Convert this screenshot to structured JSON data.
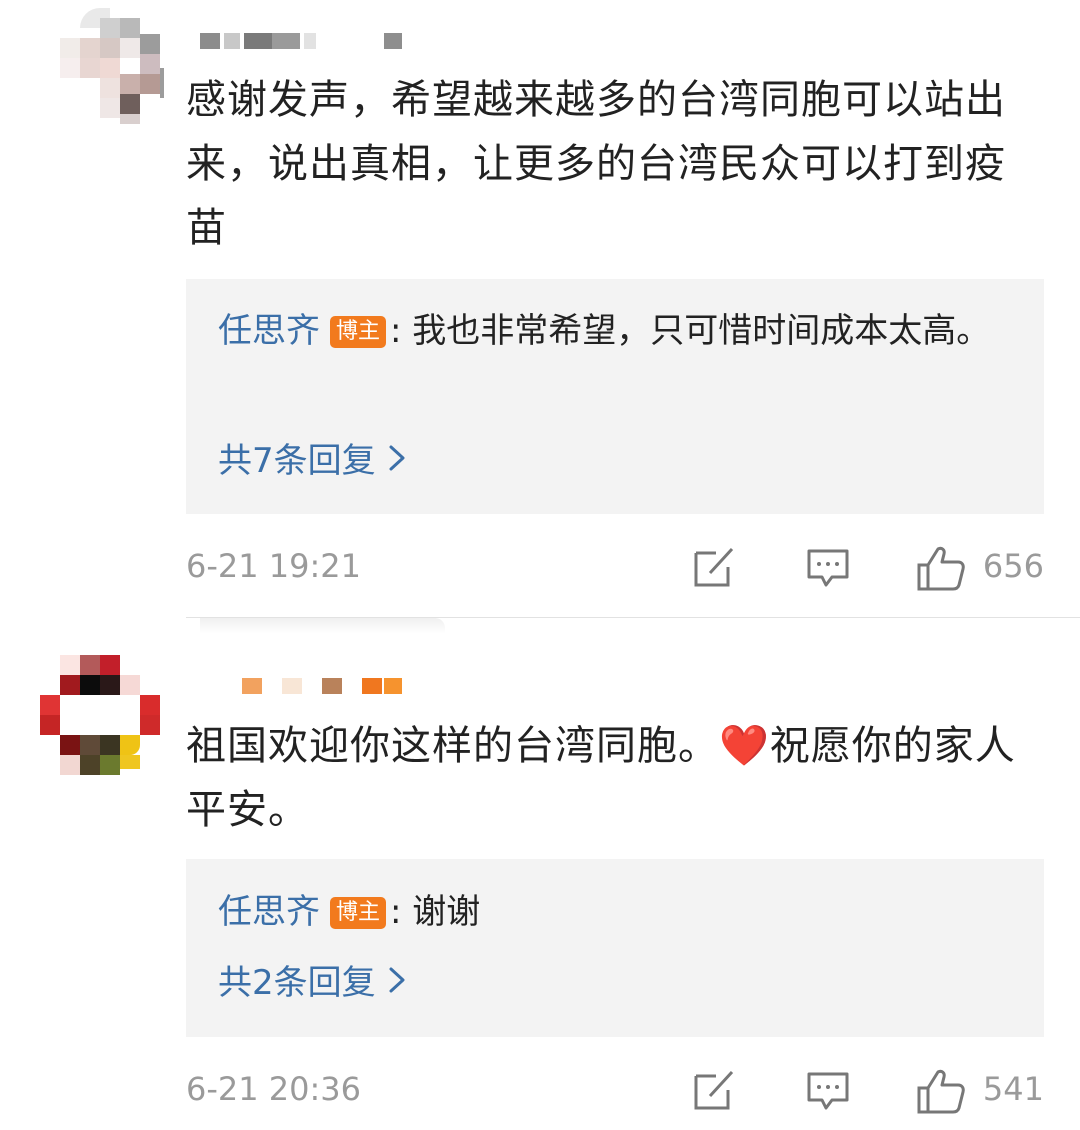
{
  "comments": [
    {
      "content": "感谢发声，希望越来越多的台湾同胞可以站出来，说出真相，让更多的台湾民众可以打到疫苗",
      "reply": {
        "author": "任思齐",
        "badge": "博主",
        "separator": ":",
        "text": " 我也非常希望，只可惜时间成本太高。",
        "more": "共7条回复"
      },
      "time": "6-21 19:21",
      "likes": "656",
      "icons": {
        "share": "share-icon",
        "comment": "comment-icon",
        "like": "thumbs-up-icon"
      }
    },
    {
      "content": "祖国欢迎你这样的台湾同胞。❤️祝愿你的家人平安。",
      "reply": {
        "author": "任思齐",
        "badge": "博主",
        "separator": ":",
        "text": " 谢谢",
        "more": "共2条回复"
      },
      "time": "6-21 20:36",
      "likes": "541",
      "icons": {
        "share": "share-icon",
        "comment": "comment-icon",
        "like": "thumbs-up-icon"
      }
    }
  ],
  "colors": {
    "link": "#3b6fa8",
    "badge": "#f27a1d",
    "reply_bg": "#f3f3f3",
    "meta": "#9a9a9a"
  }
}
